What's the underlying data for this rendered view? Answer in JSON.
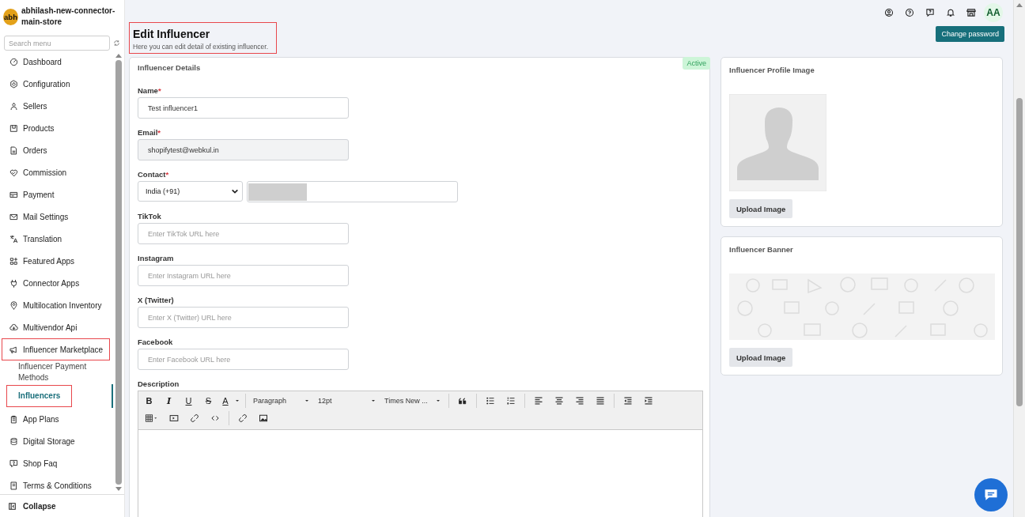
{
  "store": {
    "initials": "abh",
    "name": "abhilash-new-connector-main-store"
  },
  "search": {
    "placeholder": "Search menu"
  },
  "sidebar": {
    "items": [
      {
        "label": "Dashboard",
        "selected": false,
        "highlighted": false
      },
      {
        "label": "Configuration",
        "selected": false,
        "highlighted": false
      },
      {
        "label": "Sellers",
        "selected": false,
        "highlighted": false
      },
      {
        "label": "Products",
        "selected": false,
        "highlighted": false
      },
      {
        "label": "Orders",
        "selected": false,
        "highlighted": false
      },
      {
        "label": "Commission",
        "selected": false,
        "highlighted": false
      },
      {
        "label": "Payment",
        "selected": false,
        "highlighted": false
      },
      {
        "label": "Mail Settings",
        "selected": false,
        "highlighted": false
      },
      {
        "label": "Translation",
        "selected": false,
        "highlighted": false
      },
      {
        "label": "Featured Apps",
        "selected": false,
        "highlighted": false
      },
      {
        "label": "Connector Apps",
        "selected": false,
        "highlighted": false
      },
      {
        "label": "Multilocation Inventory",
        "selected": false,
        "highlighted": false
      },
      {
        "label": "Multivendor Api",
        "selected": false,
        "highlighted": false
      },
      {
        "label": "Influencer Marketplace",
        "selected": false,
        "highlighted": true,
        "children": [
          {
            "label": "Influencer Payment Methods",
            "selected": false,
            "highlighted": false
          },
          {
            "label": "Influencers",
            "selected": true,
            "highlighted": true
          }
        ]
      },
      {
        "label": "App Plans",
        "selected": false,
        "highlighted": false
      },
      {
        "label": "Digital Storage",
        "selected": false,
        "highlighted": false
      },
      {
        "label": "Shop Faq",
        "selected": false,
        "highlighted": false
      },
      {
        "label": "Terms & Conditions",
        "selected": false,
        "highlighted": false
      }
    ],
    "collapse": "Collapse"
  },
  "topbar": {
    "avatar": "AA"
  },
  "header": {
    "title": "Edit Influencer",
    "subtitle": "Here you can edit detail of existing influencer.",
    "highlighted": true
  },
  "change_password": "Change password",
  "details": {
    "title": "Influencer Details",
    "status": "Active",
    "fields": [
      {
        "kind": "text",
        "label": "Name",
        "required_mark": "*",
        "value": "Test influencer1",
        "disabled": false
      },
      {
        "kind": "text",
        "label": "Email",
        "required_mark": "*",
        "value": "shopifytest@webkul.in",
        "disabled": true
      },
      {
        "kind": "phone",
        "label": "Contact",
        "required_mark": "*",
        "country": "India (+91)"
      },
      {
        "kind": "text",
        "label": "TikTok",
        "placeholder": "Enter TikTok URL here",
        "disabled": false
      },
      {
        "kind": "text",
        "label": "Instagram",
        "placeholder": "Enter Instagram URL here",
        "disabled": false
      },
      {
        "kind": "text",
        "label": "X (Twitter)",
        "placeholder": "Enter X (Twitter) URL here",
        "disabled": false
      },
      {
        "kind": "text",
        "label": "Facebook",
        "placeholder": "Enter Facebook URL here",
        "disabled": false
      }
    ]
  },
  "description": {
    "label": "Description",
    "toolbar": {
      "format": [
        "B",
        "I",
        "U",
        "S",
        "A"
      ],
      "block": "Paragraph",
      "size": "12pt",
      "font": "Times New ..."
    }
  },
  "profile_image": {
    "title": "Influencer Profile Image",
    "button": "Upload Image"
  },
  "banner": {
    "title": "Influencer Banner",
    "button": "Upload Image"
  }
}
